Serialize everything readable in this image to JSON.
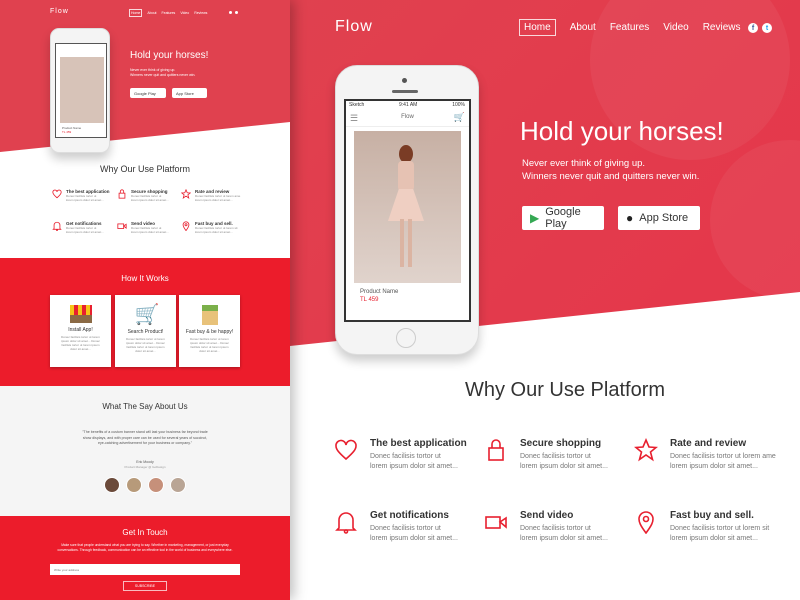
{
  "brand": "Flow",
  "nav": [
    "Home",
    "About",
    "Features",
    "Video",
    "Reviews"
  ],
  "social": {
    "facebook": "f",
    "twitter": "t"
  },
  "hero": {
    "title": "Hold your horses!",
    "line1": "Never ever think of giving up.",
    "line2": "Winners never quit and quitters never win.",
    "google_play": "Google Play",
    "app_store": "App Store"
  },
  "phone": {
    "carrier": "Sketch",
    "time": "9:41 AM",
    "battery": "100%",
    "app_title": "Flow",
    "product_name": "Product Name",
    "price": "TL 459"
  },
  "features": {
    "title": "Why Our Use Platform",
    "items": [
      {
        "icon": "heart-icon",
        "title": "The best application",
        "line1": "Donec facilisis tortor ut",
        "line2": "lorem ipsum dolor sit amet..."
      },
      {
        "icon": "lock-icon",
        "title": "Secure shopping",
        "line1": "Donec facilisis tortor ut",
        "line2": "lorem ipsum dolor sit amet..."
      },
      {
        "icon": "star-icon",
        "title": "Rate and review",
        "line1": "Donec facilisis tortor ut lorem ame",
        "line2": "lorem ipsum dolor sit amet..."
      },
      {
        "icon": "bell-icon",
        "title": "Get notifications",
        "line1": "Donec facilisis tortor ut",
        "line2": "lorem ipsum dolor sit amet..."
      },
      {
        "icon": "video-camera-icon",
        "title": "Send video",
        "line1": "Donec facilisis tortor ut",
        "line2": "lorem ipsum dolor sit amet..."
      },
      {
        "icon": "map-pin-icon",
        "title": "Fast buy and sell.",
        "line1": "Donec facilisis tortor ut lorem sit",
        "line2": "lorem ipsum dolor sit amet..."
      }
    ]
  },
  "how": {
    "title": "How It Works",
    "cards": [
      {
        "icon": "shop-stall-icon",
        "title": "Install App!",
        "text": "Donec facilisis tortor ut lorem ipsum dolor sit amet... Donec facilisis tortor ut lorem ipsum dolor sit amet..."
      },
      {
        "icon": "shopping-cart-icon",
        "title": "Search Product!",
        "text": "Donec facilisis tortor ut lorem ipsum dolor sit amet... Donec facilisis tortor ut lorem ipsum dolor sit amet..."
      },
      {
        "icon": "grocery-bag-icon",
        "title": "Fast buy & be happy!",
        "text": "Donec facilisis tortor ut lorem ipsum dolor sit amet... Donec facilisis tortor ut lorem ipsum dolor sit amet..."
      }
    ]
  },
  "testimonials": {
    "title": "What The Say About Us",
    "quote": "\"The benefits of a custom banner stand will last your business far beyond trade show displays, and with proper care can be used for several years of succinct, eye-catching advertisement for your business or company.\"",
    "name": "Eric Moody",
    "role": "Product Manager @ GoDesign"
  },
  "contact": {
    "title": "Get In Touch",
    "text": "Make sure that people understand what you are trying to say. Whether in marketing, management, or just everyday conversations. Through feedback, communication can be an effective tool in the world of business and everywhere else.",
    "placeholder": "Write your address",
    "subscribe": "SUBSCRIBE"
  },
  "colors": {
    "hero": "#e0414f",
    "accent": "#ec1c2b",
    "icon": "#e8202f"
  }
}
